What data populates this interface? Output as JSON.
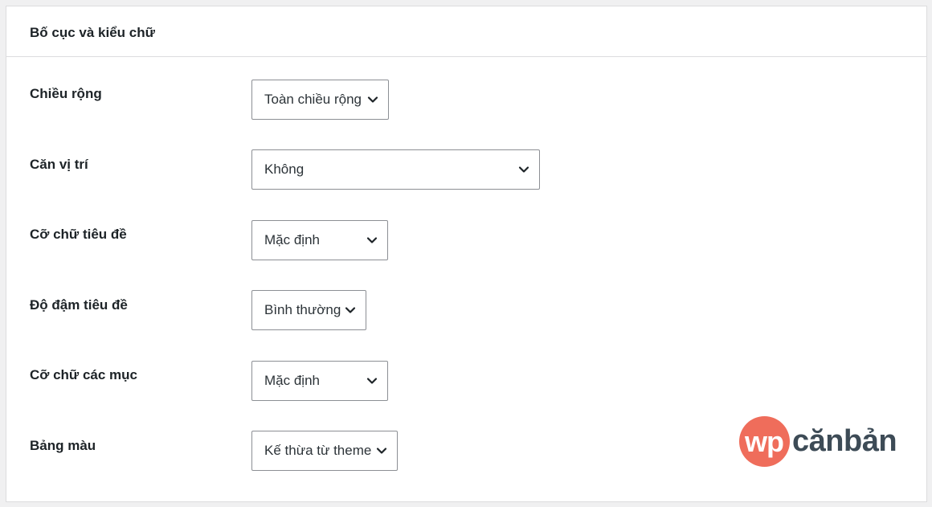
{
  "panel": {
    "title": "Bố cục và kiểu chữ"
  },
  "settings": [
    {
      "label": "Chiều rộng",
      "value": "Toàn chiều rộng"
    },
    {
      "label": "Căn vị trí",
      "value": "Không"
    },
    {
      "label": "Cỡ chữ tiêu đề",
      "value": "Mặc định"
    },
    {
      "label": "Độ đậm tiêu đề",
      "value": "Bình thường"
    },
    {
      "label": "Cỡ chữ các mục",
      "value": "Mặc định"
    },
    {
      "label": "Bảng màu",
      "value": "Kế thừa từ theme"
    }
  ],
  "icons": {
    "dropdown": "chevron-down-icon"
  },
  "logo": {
    "mark": "wp",
    "text": "cănbản",
    "mark_color": "#ef6d5b",
    "text_color": "#3d4b56"
  }
}
